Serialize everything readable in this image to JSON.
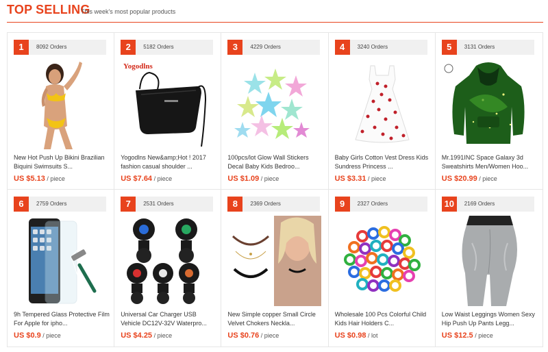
{
  "header": {
    "title": "TOP SELLING",
    "subtitle": "This week's most popular products"
  },
  "colors": {
    "accent": "#e8431d",
    "badge_bg": "#f0f0f0"
  },
  "products": [
    {
      "rank": "1",
      "orders": "8092 Orders",
      "name": "New Hot Push Up Bikini Brazilian Biquini Swimsuits S...",
      "price": "US $5.13",
      "unit": "/ piece",
      "icon": "bikini-image"
    },
    {
      "rank": "2",
      "orders": "5182 Orders",
      "name": "Yogodlns New&amp;Hot ! 2017 fashion casual shoulder ...",
      "price": "US $7.64",
      "unit": "/ piece",
      "icon": "shoulder-bag-image",
      "brand": "Yogodlns"
    },
    {
      "rank": "3",
      "orders": "4229 Orders",
      "name": "100pcs/lot Glow Wall Stickers Decal Baby Kids Bedroo...",
      "price": "US $1.09",
      "unit": "/ piece",
      "icon": "glow-stars-image"
    },
    {
      "rank": "4",
      "orders": "3240 Orders",
      "name": "Baby Girls Cotton Vest Dress Kids Sundress Princess ...",
      "price": "US $3.31",
      "unit": "/ piece",
      "icon": "cherry-dress-image"
    },
    {
      "rank": "5",
      "orders": "3131 Orders",
      "name": "Mr.1991INC Space Galaxy 3d Sweatshirts Men/Women Hoo...",
      "price": "US $20.99",
      "unit": "/ piece",
      "icon": "galaxy-hoodie-image"
    },
    {
      "rank": "6",
      "orders": "2759 Orders",
      "name": "9h Tempered Glass Protective Film For Apple for ipho...",
      "price": "US $0.9",
      "unit": "/ piece",
      "icon": "phone-glass-image"
    },
    {
      "rank": "7",
      "orders": "2531 Orders",
      "name": "Universal Car Charger USB Vehicle DC12V-32V Waterpro...",
      "price": "US $4.25",
      "unit": "/ piece",
      "icon": "car-charger-image"
    },
    {
      "rank": "8",
      "orders": "2369 Orders",
      "name": "New Simple copper Small Circle Velvet Chokers Neckla...",
      "price": "US $0.76",
      "unit": "/ piece",
      "icon": "choker-necklace-image"
    },
    {
      "rank": "9",
      "orders": "2327 Orders",
      "name": "Wholesale 100 Pcs Colorful Child Kids Hair Holders C...",
      "price": "US $0.98",
      "unit": "/ lot",
      "icon": "hair-ties-image"
    },
    {
      "rank": "10",
      "orders": "2169 Orders",
      "name": "Low Waist Leggings Women Sexy Hip Push Up Pants Legg...",
      "price": "US $12.5",
      "unit": "/ piece",
      "icon": "leggings-image"
    }
  ]
}
